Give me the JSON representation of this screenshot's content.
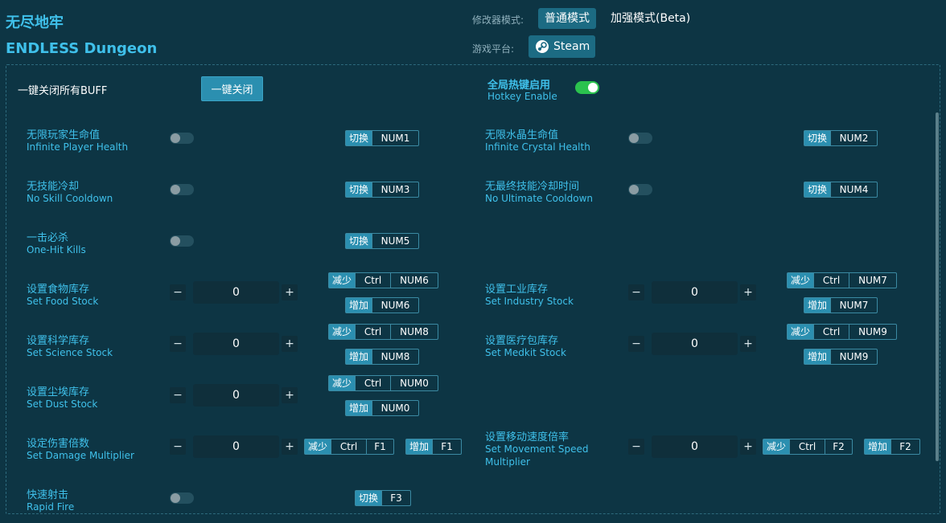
{
  "header": {
    "title_cn": "无尽地牢",
    "title_en": "ENDLESS Dungeon",
    "mode_label": "修改器模式:",
    "mode_normal": "普通模式",
    "mode_enhanced": "加强模式(Beta)",
    "platform_label": "游戏平台:",
    "platform": "Steam"
  },
  "global": {
    "close_all_label": "一键关闭所有BUFF",
    "close_all_button": "一键关闭",
    "hotkey_cn": "全局热键启用",
    "hotkey_en": "Hotkey Enable",
    "hotkey_enabled": true
  },
  "labels": {
    "toggle": "切换",
    "decrease": "减少",
    "increase": "增加",
    "ctrl": "Ctrl",
    "minus": "−",
    "plus": "+"
  },
  "options": {
    "o1": {
      "cn": "无限玩家生命值",
      "en": "Infinite Player Health",
      "key": "NUM1",
      "on": false
    },
    "o2": {
      "cn": "无限水晶生命值",
      "en": "Infinite Crystal Health",
      "key": "NUM2",
      "on": false
    },
    "o3": {
      "cn": "无技能冷却",
      "en": "No Skill Cooldown",
      "key": "NUM3",
      "on": false
    },
    "o4": {
      "cn": "无最终技能冷却时间",
      "en": "No Ultimate Cooldown",
      "key": "NUM4",
      "on": false
    },
    "o5": {
      "cn": "一击必杀",
      "en": "One-Hit Kills",
      "key": "NUM5",
      "on": false
    },
    "o6": {
      "cn": "设置食物库存",
      "en": "Set Food Stock",
      "value": "0",
      "dec_key": "NUM6",
      "inc_key": "NUM6"
    },
    "o7": {
      "cn": "设置工业库存",
      "en": "Set Industry Stock",
      "value": "0",
      "dec_key": "NUM7",
      "inc_key": "NUM7"
    },
    "o8": {
      "cn": "设置科学库存",
      "en": "Set Science Stock",
      "value": "0",
      "dec_key": "NUM8",
      "inc_key": "NUM8"
    },
    "o9": {
      "cn": "设置医疗包库存",
      "en": "Set Medkit Stock",
      "value": "0",
      "dec_key": "NUM9",
      "inc_key": "NUM9"
    },
    "o10": {
      "cn": "设置尘埃库存",
      "en": "Set Dust Stock",
      "value": "0",
      "dec_key": "NUM0",
      "inc_key": "NUM0"
    },
    "o11": {
      "cn": "设定伤害倍数",
      "en": "Set Damage Multiplier",
      "value": "0",
      "dec_key": "F1",
      "inc_key": "F1"
    },
    "o12": {
      "cn": "设置移动速度倍率",
      "en": "Set Movement Speed Multiplier",
      "value": "0",
      "dec_key": "F2",
      "inc_key": "F2"
    },
    "o13": {
      "cn": "快速射击",
      "en": "Rapid Fire",
      "key": "F3",
      "on": false
    }
  },
  "colors": {
    "background": "#0d3544",
    "accent": "#3fc0ea",
    "button": "#2b8fb0",
    "toggle_on": "#2bc24e"
  }
}
